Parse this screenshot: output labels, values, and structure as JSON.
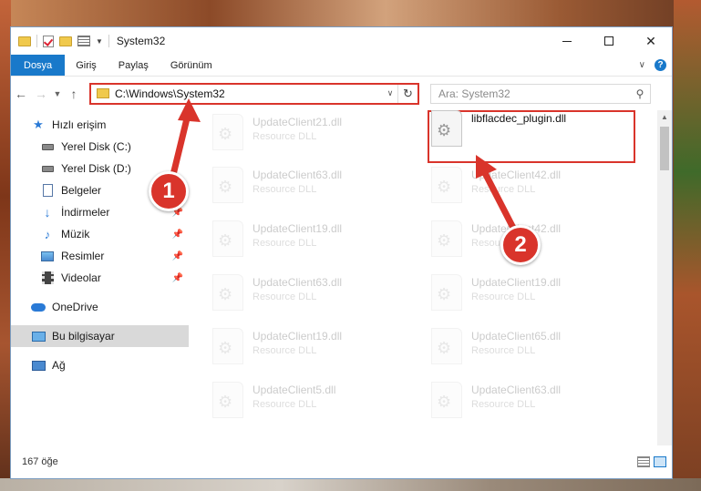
{
  "window": {
    "title": "System32"
  },
  "ribbon": {
    "tabs": [
      "Dosya",
      "Giriş",
      "Paylaş",
      "Görünüm"
    ]
  },
  "address": {
    "path": "C:\\Windows\\System32",
    "search_placeholder": "Ara: System32"
  },
  "sidebar": {
    "items": [
      {
        "label": "Hızlı erişim"
      },
      {
        "label": "Yerel Disk (C:)"
      },
      {
        "label": "Yerel Disk (D:)"
      },
      {
        "label": "Belgeler"
      },
      {
        "label": "İndirmeler"
      },
      {
        "label": "Müzik"
      },
      {
        "label": "Resimler"
      },
      {
        "label": "Videolar"
      },
      {
        "label": "OneDrive"
      },
      {
        "label": "Bu bilgisayar"
      },
      {
        "label": "Ağ"
      }
    ]
  },
  "files": {
    "highlighted": {
      "name": "libflacdec_plugin.dll"
    },
    "left": [
      {
        "name": "UpdateClient21.dll",
        "type": "Resource DLL"
      },
      {
        "name": "UpdateClient63.dll",
        "type": "Resource DLL"
      },
      {
        "name": "UpdateClient19.dll",
        "type": "Resource DLL"
      },
      {
        "name": "UpdateClient63.dll",
        "type": "Resource DLL"
      },
      {
        "name": "UpdateClient19.dll",
        "type": "Resource DLL"
      },
      {
        "name": "UpdateClient5.dll",
        "type": "Resource DLL"
      }
    ],
    "right": [
      {
        "name": "UpdateClient42.dll",
        "type": "Resource DLL"
      },
      {
        "name": "UpdateClient42.dll",
        "type": "Resource DLL"
      },
      {
        "name": "UpdateClient19.dll",
        "type": "Resource DLL"
      },
      {
        "name": "UpdateClient65.dll",
        "type": "Resource DLL"
      },
      {
        "name": "UpdateClient63.dll",
        "type": "Resource DLL"
      }
    ]
  },
  "status": {
    "count": "167 öğe"
  },
  "annotations": {
    "step1": "1",
    "step2": "2",
    "color": "#d9342b"
  }
}
